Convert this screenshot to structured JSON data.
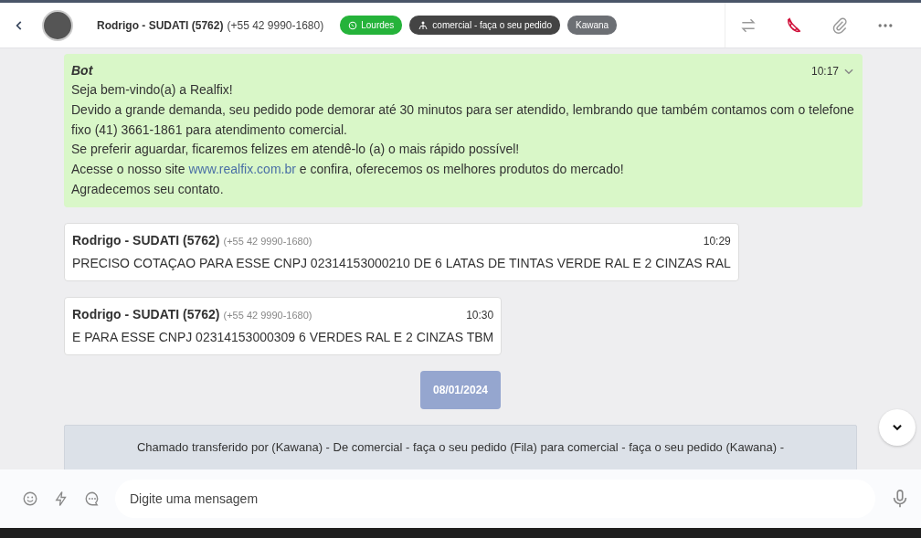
{
  "header": {
    "contact_name": "Rodrigo - SUDATI (5762)",
    "contact_phone": "(+55 42 9990-1680)",
    "tags": [
      {
        "kind": "whatsapp",
        "label": "Lourdes",
        "color": "#25b33a"
      },
      {
        "kind": "queue",
        "label": "comercial - faça o seu pedido",
        "color": "#444444"
      },
      {
        "kind": "plain",
        "label": "Kawana",
        "color": "#6c6f74"
      }
    ]
  },
  "messages": [
    {
      "kind": "bot",
      "sender": "Bot",
      "time": "10:17",
      "lines": [
        {
          "text": "Seja bem-vindo(a) a Realfix!"
        },
        {
          "text": "Devido a grande demanda, seu pedido pode demorar até 30 minutos para ser atendido, lembrando que também contamos com o telefone fixo (41) 3661-1861 para atendimento comercial."
        },
        {
          "text": "Se preferir aguardar, ficaremos felizes em atendê-lo (a) o mais rápido possível!"
        },
        {
          "text": "Acesse o nosso site ",
          "link": "www.realfix.com.br",
          "after": " e confira, oferecemos os melhores produtos do mercado!"
        },
        {
          "text": "Agradecemos seu contato."
        }
      ]
    },
    {
      "kind": "contact",
      "sender": "Rodrigo - SUDATI (5762)",
      "phone": "(+55 42 9990-1680)",
      "time": "10:29",
      "text": "PRECISO COTAÇAO PARA ESSE CNPJ 02314153000210 DE 6 LATAS DE TINTAS VERDE RAL E 2 CINZAS RAL"
    },
    {
      "kind": "contact",
      "sender": "Rodrigo - SUDATI (5762)",
      "phone": "(+55 42 9990-1680)",
      "time": "10:30",
      "text": "E PARA ESSE CNPJ 02314153000309 6 VERDES RAL E 2 CINZAS TBM"
    },
    {
      "kind": "date",
      "text": "08/01/2024"
    },
    {
      "kind": "system",
      "text": "Chamado transferido por (Kawana) - De comercial - faça o seu pedido (Fila) para comercial - faça o seu pedido (Kawana) -"
    }
  ],
  "composer": {
    "placeholder": "Digite uma mensagem"
  }
}
